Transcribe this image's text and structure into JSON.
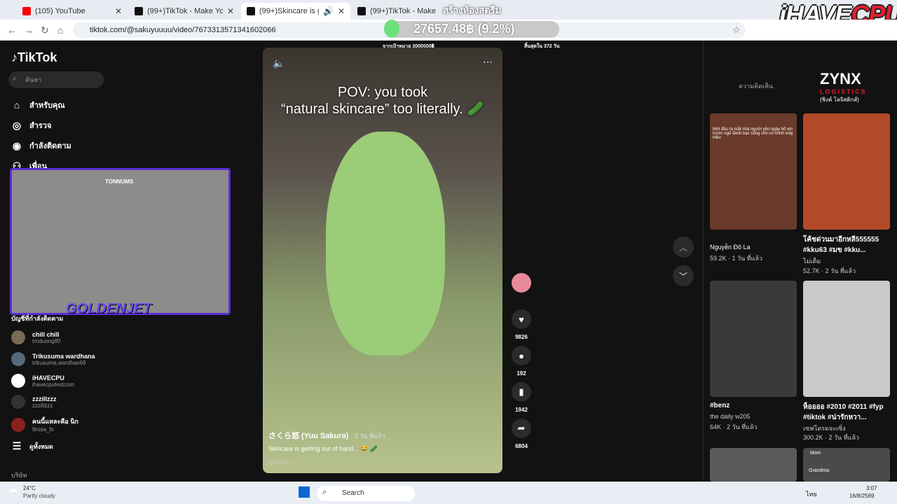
{
  "tabs": [
    {
      "title": "(105) YouTube",
      "color": "#ff0000"
    },
    {
      "title": "(99+)TikTok - Make Your Day",
      "color": "#111111"
    },
    {
      "title": "(99+)Skincare is getting ou",
      "color": "#111111"
    },
    {
      "title": "(99+)TikTok - Make Your Day",
      "color": "#111111"
    }
  ],
  "overlay": {
    "banner": "สร้างห้องสตรีม",
    "amount": "27657.48฿ (9.2%)",
    "goal": "จากเป้าหมาย 3000000฿",
    "days": "สิ้นสุดใน 372 วัน"
  },
  "brand": {
    "a": "iHAVE",
    "b": "CPU"
  },
  "address": {
    "url": "tiktok.com/@sakuyuuuu/video/7673313571341602066"
  },
  "sidebar": {
    "logo": "TikTok",
    "search_placeholder": "ค้นหา",
    "nav": [
      {
        "label": "สำหรับคุณ",
        "icon": "home-icon"
      },
      {
        "label": "สำรวจ",
        "icon": "compass-icon"
      },
      {
        "label": "กำลังติดตาม",
        "icon": "following-icon"
      },
      {
        "label": "เพื่อน",
        "icon": "friends-icon"
      }
    ],
    "following_header": "บัญชีที่กำลังติดตาม",
    "accounts": [
      {
        "name": "chill chill",
        "handle": "trnduong80",
        "color": "#7a6b55"
      },
      {
        "name": "Trikusuma wardhana",
        "handle": "trikusuma.wardhan69",
        "color": "#556a7a"
      },
      {
        "name": "iHAVECPU",
        "handle": "ihavecputestcom",
        "color": "#ffffff"
      },
      {
        "name": "zzzillzzz",
        "handle": "zzzillzzz",
        "color": "#333333"
      },
      {
        "name": "คนนี้แหละคือ นิก",
        "handle": "9rosa_fx",
        "color": "#8a2020"
      }
    ],
    "see_all": "ดูทั้งหมด",
    "company": "บริษัท"
  },
  "stream": {
    "tag": "TONNUMS",
    "name": "GOLDENJET"
  },
  "video": {
    "caption_line1": "POV: you took",
    "caption_line2": "“natural skincare” too literally. 🥒",
    "author": "さくら悠 (Yuu Sakura)",
    "age": "· 2 วัน ที่แล้ว",
    "desc": "Skincare is getting out of hand... 😂 🥒",
    "translate": "ดูคำแปล"
  },
  "actions": {
    "likes": "9826",
    "comments": "192",
    "saves": "1942",
    "shares": "6804"
  },
  "right_panel": {
    "tab": "ความคิดเห็น",
    "zynx": "ZYNX",
    "zynx_sub": "LOGISTICS",
    "zynx_th": "(ซิงค์ โลจิสติกส์)",
    "cards": [
      {
        "title": "",
        "author": "Nguyễn Đô La",
        "stats": "59.2K · 1 วัน ที่แล้ว",
        "overlay": "Mới đầu ra mắt nhà người yêu ngày bố em trước ngõ đánh bạc cũng còn có mình mấy triệu",
        "color": "#6a3a2a"
      },
      {
        "title": "โค้ชด่วนมาอีกหลี555555 #kku63 #มข #kku...",
        "author": "ไม่เต็ม",
        "stats": "52.7K · 2 วัน ที่แล้ว",
        "overlay": "",
        "color": "#b24a2a"
      },
      {
        "title": "#benz",
        "author": "the daily w205",
        "stats": "64K · 2 วัน ที่แล้ว",
        "overlay": "",
        "color": "#3a3a3a"
      },
      {
        "title": "ห็ออออ #2010 #2011 #fyp #tiktok #น่ารักหวา...",
        "author": "เซฟโดรดจะเซิ่ง",
        "stats": "300.2K · 2 วัน ที่แล้ว",
        "overlay": "",
        "color": "#c9c9c9"
      }
    ],
    "more_label_a": "Mom",
    "more_label_b": "Grandma"
  },
  "taskbar": {
    "temp": "24°C",
    "weather": "Partly cloudy",
    "search": "Search",
    "lang": "ไทย",
    "time": "3:07",
    "date": "16/8/2569"
  }
}
